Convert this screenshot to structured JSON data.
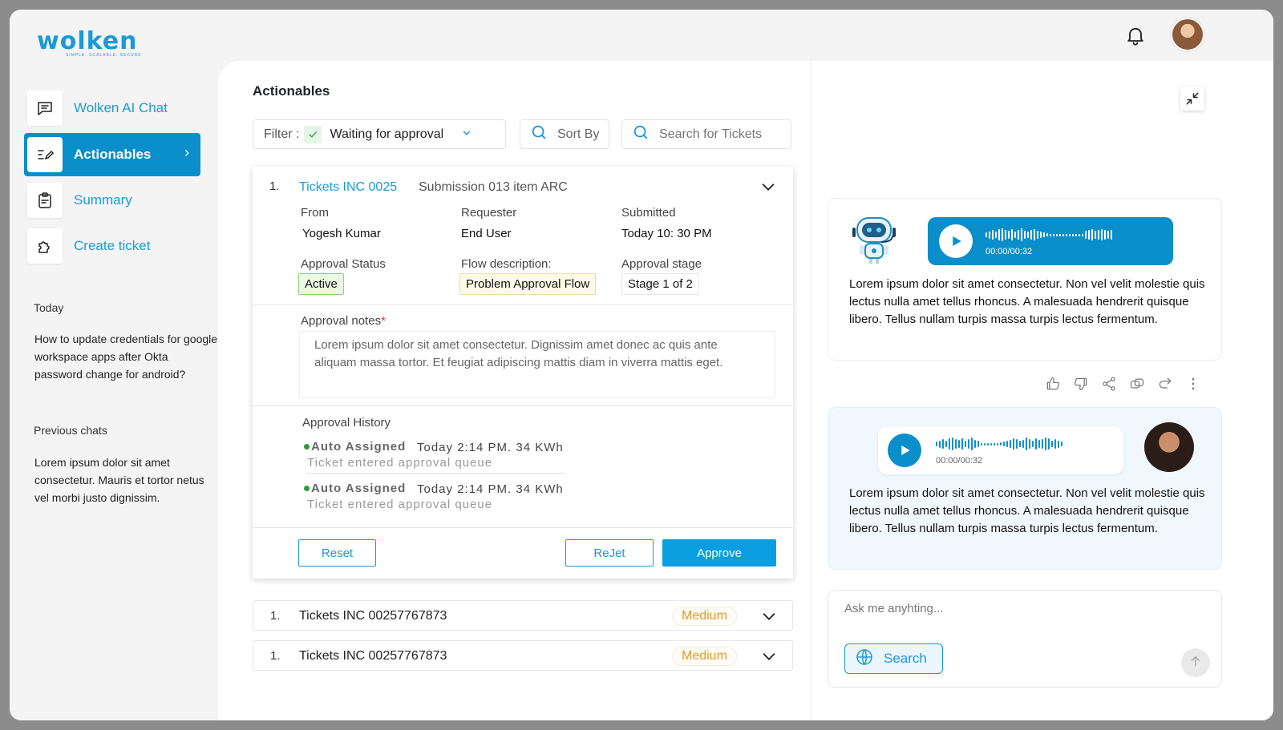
{
  "brand": {
    "name": "wolken",
    "tagline": "SIMPLE. SCALABLE. SECURE"
  },
  "sidebar": {
    "items": [
      {
        "label": "Wolken AI Chat",
        "active": false
      },
      {
        "label": "Actionables",
        "active": true
      },
      {
        "label": "Summary",
        "active": false
      },
      {
        "label": "Create ticket",
        "active": false
      }
    ],
    "today_heading": "Today",
    "today_chat": "How to update credentials for google workspace apps after Okta password change for android?",
    "previous_heading": "Previous chats",
    "previous_chat": "Lorem ipsum dolor sit amet consectetur. Mauris et tortor netus vel morbi justo dignissim."
  },
  "actionables": {
    "title": "Actionables",
    "filter_label": "Filter :",
    "filter_value": "Waiting for approval",
    "sort_label": "Sort By",
    "search_placeholder": "Search for Tickets",
    "ticket": {
      "index": "1.",
      "id": "Tickets INC 0025",
      "subtitle": "Submission 013 item ARC",
      "from_label": "From",
      "from_value": "Yogesh Kumar",
      "requester_label": "Requester",
      "requester_value": "End User",
      "submitted_label": "Submitted",
      "submitted_value": "Today 10: 30 PM",
      "status_label": "Approval Status",
      "status_value": "Active",
      "flow_label": "Flow description:",
      "flow_value": "Problem Approval Flow",
      "stage_label": "Approval stage",
      "stage_value": "Stage 1 of 2",
      "notes_label": "Approval notes",
      "notes_required": "*",
      "notes_value": "Lorem ipsum dolor sit amet consectetur. Dignissim amet donec ac quis ante aliquam massa tortor. Et feugiat adipiscing mattis diam in viverra mattis eget.",
      "history_title": "Approval History",
      "history": [
        {
          "status": "Auto Assigned",
          "time": "Today 2:14 PM. 34 KWh",
          "desc": "Ticket entered approval queue"
        },
        {
          "status": "Auto Assigned",
          "time": "Today 2:14 PM. 34 KWh",
          "desc": "Ticket entered approval queue"
        }
      ],
      "reset_label": "Reset",
      "reject_label": "ReJet",
      "approve_label": "Approve"
    },
    "rows": [
      {
        "index": "1.",
        "label": "Tickets INC 00257767873",
        "priority": "Medium"
      },
      {
        "index": "1.",
        "label": "Tickets INC 00257767873",
        "priority": "Medium"
      }
    ]
  },
  "chat": {
    "bot_message": {
      "audio_time": "00:00/00:32",
      "text": "Lorem ipsum dolor sit amet consectetur. Non vel velit molestie quis lectus nulla amet tellus rhoncus. A malesuada hendrerit quisque libero. Tellus nullam turpis massa turpis lectus fermentum."
    },
    "user_message": {
      "audio_time": "00:00/00:32",
      "text": "Lorem ipsum dolor sit amet consectetur. Non vel velit molestie quis lectus nulla amet tellus rhoncus. A malesuada hendrerit quisque libero. Tellus nullam turpis massa turpis lectus fermentum."
    },
    "input_placeholder": "Ask me anyhting...",
    "search_label": "Search"
  },
  "colors": {
    "accent": "#1a9ad6",
    "primary_button": "#0a9ee0",
    "active_sidebar": "#0a8fcb",
    "priority_medium": "#e8961f",
    "user_bubble_bg": "#f0f8fd"
  },
  "icons": [
    "bell-icon",
    "chat-icon",
    "edit-list-icon",
    "clipboard-icon",
    "puzzle-icon",
    "check-icon",
    "chevron-down-icon",
    "search-icon",
    "collapse-icon",
    "play-icon",
    "thumbs-up-icon",
    "thumbs-down-icon",
    "share-icon",
    "copy-icon",
    "redo-icon",
    "more-icon",
    "globe-icon",
    "arrow-up-icon"
  ]
}
